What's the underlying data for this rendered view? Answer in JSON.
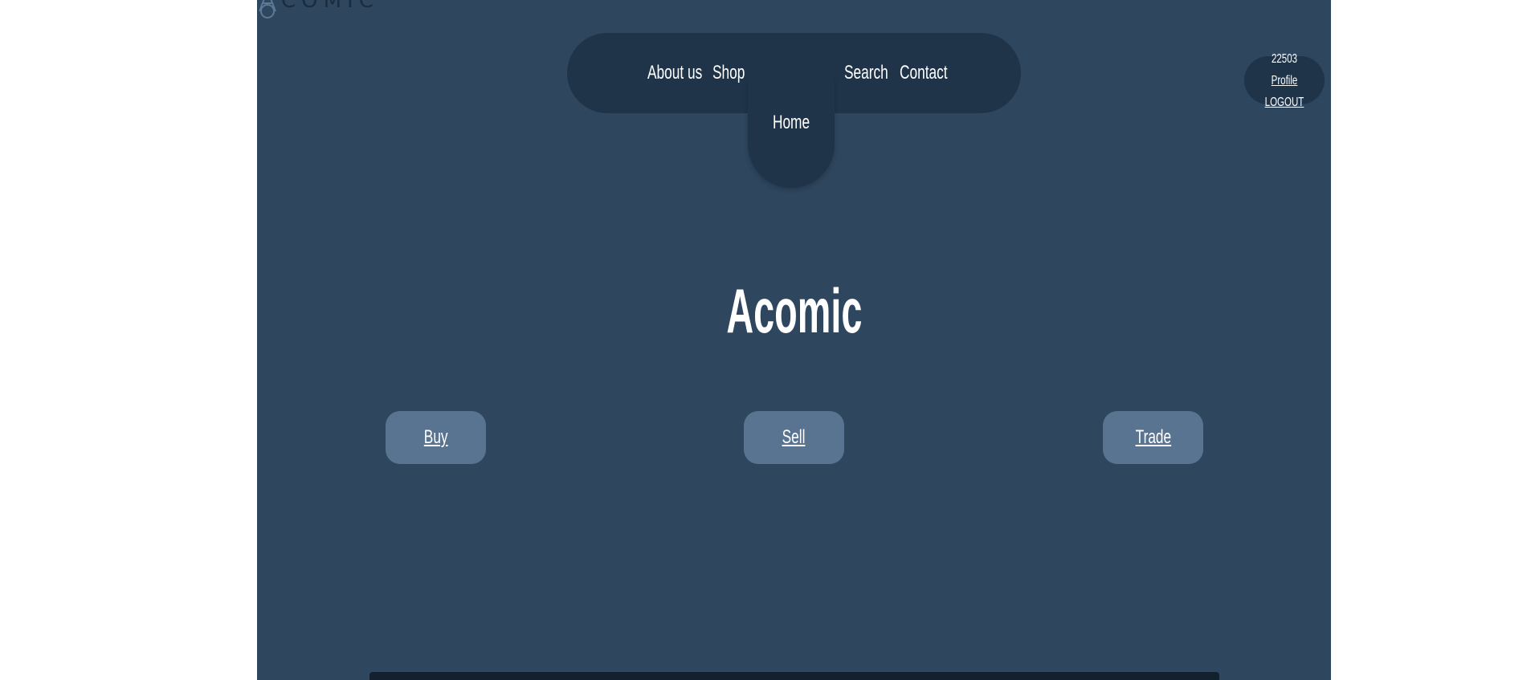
{
  "brand": {
    "logo_text": "COMIC",
    "logo_icon": "letter-a-logo-icon"
  },
  "nav": {
    "about_label": "About us",
    "shop_label": "Shop",
    "home_label": "Home",
    "search_label": "Search",
    "contact_label": "Contact"
  },
  "user": {
    "id": "22503",
    "profile_label": "Profile",
    "logout_label": "LOGOUT"
  },
  "hero": {
    "title": "Acomic"
  },
  "actions": {
    "buy_label": "Buy",
    "sell_label": "Sell",
    "trade_label": "Trade"
  },
  "colors": {
    "page_background": "#2e465e",
    "nav_background": "#203449",
    "button_background": "#587491",
    "footer_bar": "#13202e"
  }
}
